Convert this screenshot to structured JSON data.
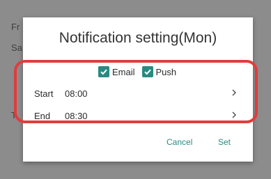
{
  "background": {
    "line1": "Fr",
    "line2": "Sa",
    "line3": "T"
  },
  "dialog": {
    "title": "Notification setting(Mon)",
    "checkboxes": [
      {
        "label": "Email",
        "checked": true
      },
      {
        "label": "Push",
        "checked": true
      }
    ],
    "rows": [
      {
        "label": "Start",
        "value": "08:00"
      },
      {
        "label": "End",
        "value": "08:30"
      }
    ],
    "cancel_label": "Cancel",
    "set_label": "Set"
  },
  "colors": {
    "accent": "#2a8a80",
    "highlight": "#e23c3c",
    "backdrop": "#8c8c8c"
  },
  "icons": {
    "checkbox": "checkmark-icon",
    "row_arrow": "chevron-right-icon"
  }
}
